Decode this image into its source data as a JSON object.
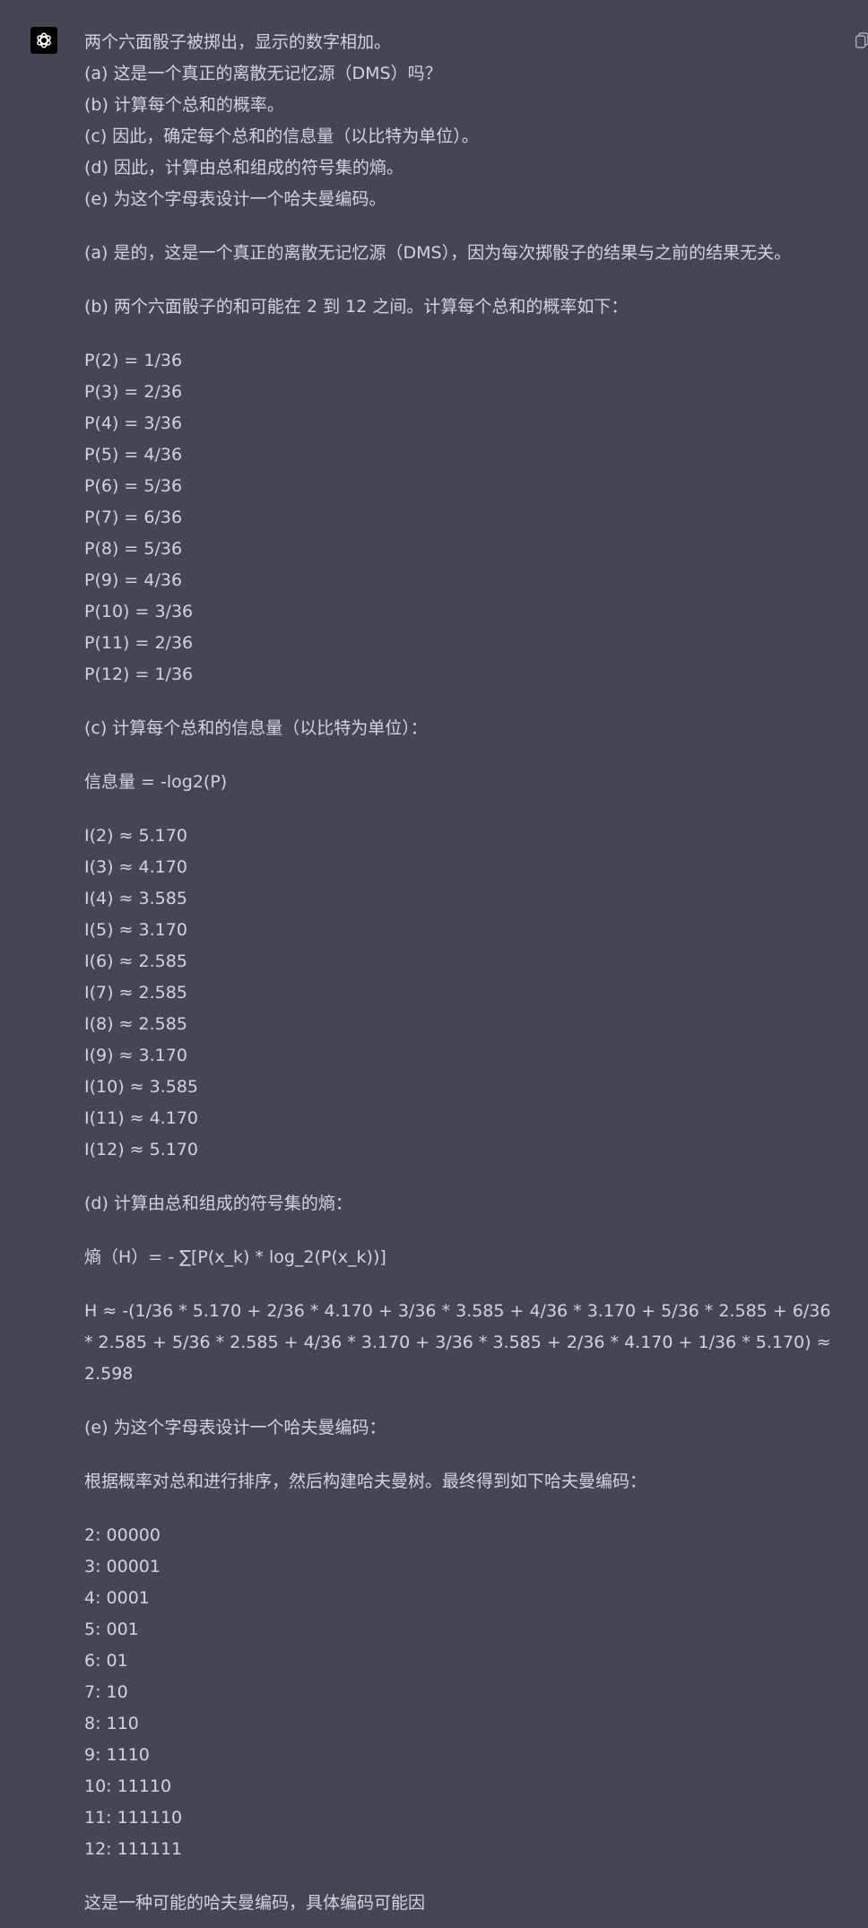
{
  "question": [
    "两个六面骰子被掷出，显示的数字相加。",
    "(a) 这是一个真正的离散无记忆源（DMS）吗？",
    "(b) 计算每个总和的概率。",
    "(c) 因此，确定每个总和的信息量（以比特为单位）。",
    "(d) 因此，计算由总和组成的符号集的熵。",
    "(e) 为这个字母表设计一个哈夫曼编码。"
  ],
  "answer_a": "(a) 是的，这是一个真正的离散无记忆源（DMS），因为每次掷骰子的结果与之前的结果无关。",
  "answer_b_intro": "(b) 两个六面骰子的和可能在 2 到 12 之间。计算每个总和的概率如下：",
  "probabilities": [
    "P(2) = 1/36",
    "P(3) = 2/36",
    "P(4) = 3/36",
    "P(5) = 4/36",
    "P(6) = 5/36",
    "P(7) = 6/36",
    "P(8) = 5/36",
    "P(9) = 4/36",
    "P(10) = 3/36",
    "P(11) = 2/36",
    "P(12) = 1/36"
  ],
  "answer_c_intro": "(c) 计算每个总和的信息量（以比特为单位）：",
  "info_formula": "信息量 = -log2(P)",
  "information": [
    "I(2) ≈ 5.170",
    "I(3) ≈ 4.170",
    "I(4) ≈ 3.585",
    "I(5) ≈ 3.170",
    "I(6) ≈ 2.585",
    "I(7) ≈ 2.585",
    "I(8) ≈ 2.585",
    "I(9) ≈ 3.170",
    "I(10) ≈ 3.585",
    "I(11) ≈ 4.170",
    "I(12) ≈ 5.170"
  ],
  "answer_d_intro": "(d) 计算由总和组成的符号集的熵：",
  "entropy_formula": "熵（H）= - ∑[P(x_k) * log_2(P(x_k))]",
  "entropy_calc": "H ≈ -(1/36 * 5.170 + 2/36 * 4.170 + 3/36 * 3.585 + 4/36 * 3.170 + 5/36 * 2.585 + 6/36 * 2.585 + 5/36 * 2.585 + 4/36 * 3.170 + 3/36 * 3.585 + 2/36 * 4.170 + 1/36 * 5.170) ≈ 2.598",
  "answer_e_intro": "(e) 为这个字母表设计一个哈夫曼编码：",
  "huffman_intro": "根据概率对总和进行排序，然后构建哈夫曼树。最终得到如下哈夫曼编码：",
  "huffman_codes": [
    "2: 00000",
    "3: 00001",
    "4: 0001",
    "5: 001",
    "6: 01",
    "7: 10",
    "8: 110",
    "9: 1110",
    "10: 11110",
    "11: 111110",
    "12: 111111"
  ],
  "closing": "这是一种可能的哈夫曼编码，具体编码可能因",
  "icons": {
    "avatar": "openai-logo-icon",
    "copy": "copy-icon"
  }
}
